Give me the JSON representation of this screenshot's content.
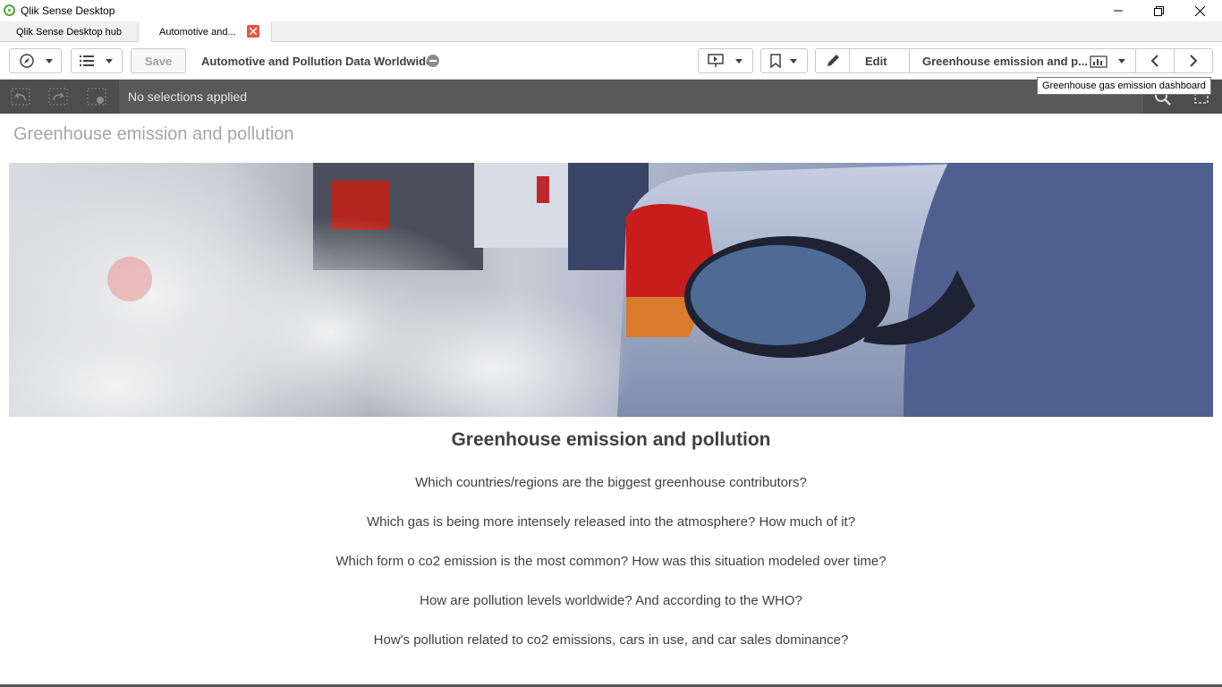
{
  "window": {
    "title": "Qlik Sense Desktop"
  },
  "tabs": [
    {
      "label": "Qlik Sense Desktop hub"
    },
    {
      "label": "Automotive and..."
    }
  ],
  "toolbar": {
    "save_label": "Save",
    "app_name": "Automotive and Pollution Data Worldwide",
    "edit_label": "Edit",
    "sheet_label": "Greenhouse emission and p..."
  },
  "tooltip": "Greenhouse gas emission dashboard",
  "selections": {
    "status": "No selections applied"
  },
  "sheet": {
    "title": "Greenhouse emission and pollution",
    "heading": "Greenhouse emission and pollution",
    "questions": [
      "Which countries/regions are the biggest greenhouse contributors?",
      "Which gas is being more intensely released into the atmosphere? How much of it?",
      "Which form o co2 emission is the most common? How was this situation modeled over time?",
      "How are pollution levels worldwide? And according to the WHO?",
      "How's pollution related to co2 emissions, cars in use, and car sales dominance?"
    ]
  },
  "colors": {
    "accent_green": "#52a535",
    "selection_bar": "#595959",
    "tab_close": "#e8563f"
  }
}
